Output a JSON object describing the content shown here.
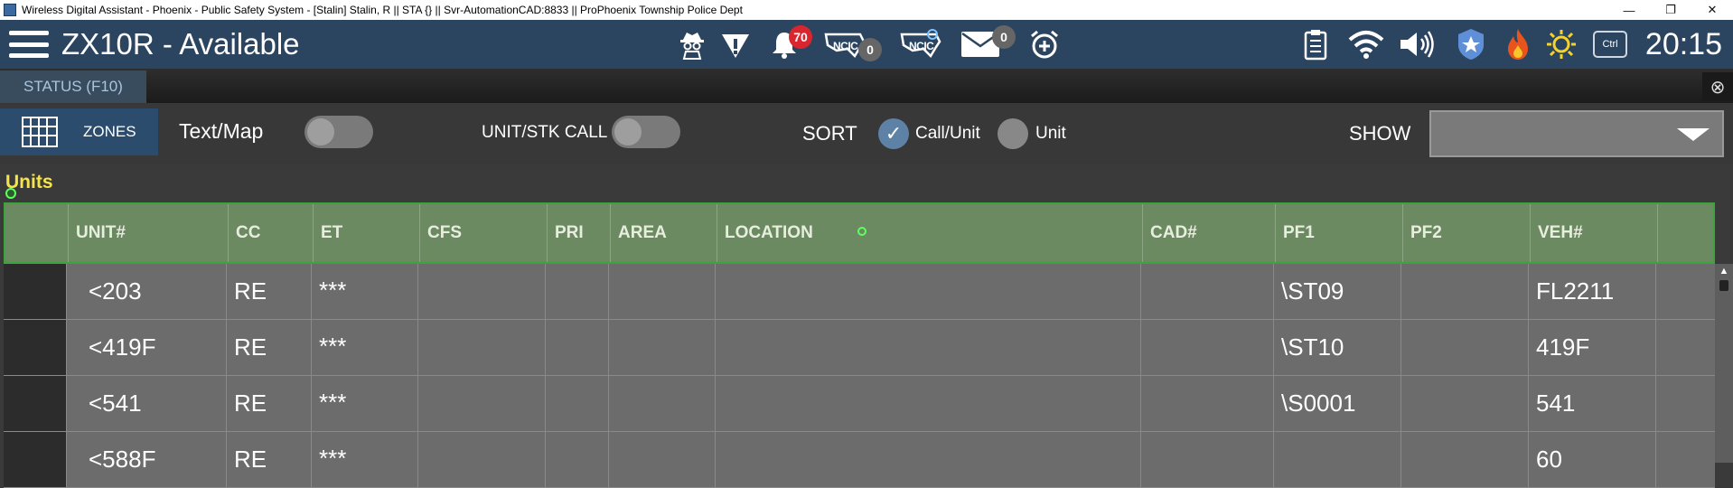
{
  "window": {
    "title": "Wireless Digital Assistant - Phoenix - Public Safety System - [Stalin] Stalin, R || STA {} || Svr-AutomationCAD:8833 || ProPhoenix Township Police Dept",
    "controls": [
      "—",
      "❐",
      "✕"
    ]
  },
  "header": {
    "unit_status": "ZX10R - Available",
    "notifications_count": "70",
    "ncic_count": "0",
    "ncic_label": "NCIC",
    "ncic2_label": "NCIC",
    "messages_count": "0",
    "ctrl_label": "Ctrl",
    "clock": "20:15",
    "icons": [
      "spy-icon",
      "alert-icon",
      "bell-icon",
      "ncic-icon",
      "ncic-search-icon",
      "mail-icon",
      "alarm-icon",
      "clipboard-icon",
      "wifi-icon",
      "speaker-icon",
      "police-badge-icon",
      "fire-icon",
      "weather-icon"
    ]
  },
  "tabs": {
    "status_tab": "STATUS (F10)",
    "close": "⊗"
  },
  "toolbar": {
    "zones_label": "ZONES",
    "textmap_label": "Text/Map",
    "unitstk_label": "UNIT/STK CALL",
    "sort_label": "SORT",
    "sort_option_1": "Call/Unit",
    "sort_option_2": "Unit",
    "sort_selected": "Call/Unit",
    "show_label": "SHOW",
    "show_value": ""
  },
  "units": {
    "section_title": "Units",
    "columns": [
      "",
      "UNIT#",
      "CC",
      "ET",
      "CFS",
      "PRI",
      "AREA",
      "LOCATION",
      "CAD#",
      "PF1",
      "PF2",
      "VEH#",
      ""
    ],
    "rows": [
      [
        "",
        "<203",
        "RE",
        "***",
        "",
        "",
        "",
        "",
        "",
        "\\ST09",
        "",
        "FL2211",
        ""
      ],
      [
        "",
        "<419F",
        "RE",
        "***",
        "",
        "",
        "",
        "",
        "",
        "\\ST10",
        "",
        "419F",
        ""
      ],
      [
        "",
        "<541",
        "RE",
        "***",
        "",
        "",
        "",
        "",
        "",
        "\\S0001",
        "",
        "541",
        ""
      ],
      [
        "",
        "<588F",
        "RE",
        "***",
        "",
        "",
        "",
        "",
        "",
        "",
        "",
        "60",
        ""
      ]
    ]
  },
  "colors": {
    "header_bg": "#2b4561",
    "accent_red": "#d9262e",
    "section_title": "#f5e44a",
    "table_header_bg": "#6b8a62",
    "table_header_border": "#3da33d"
  }
}
